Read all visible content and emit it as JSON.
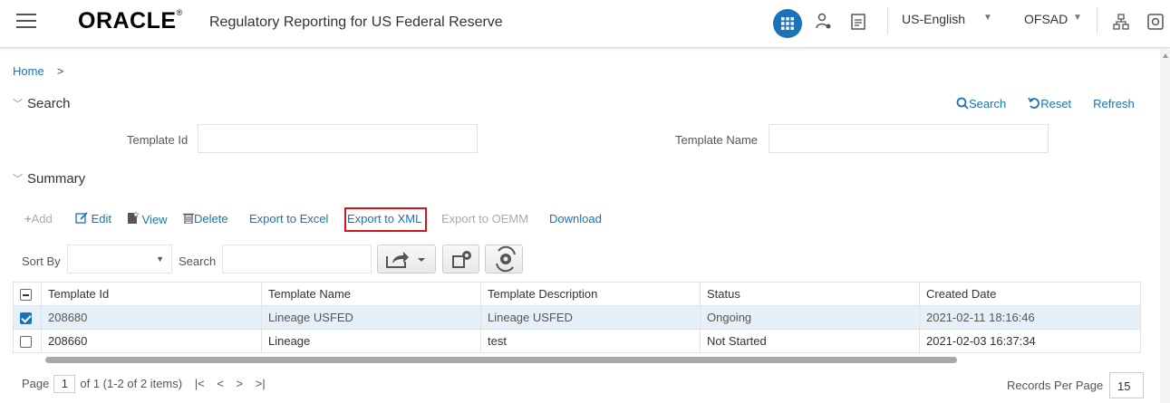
{
  "header": {
    "logo_text": "ORACLE",
    "logo_mark": "®",
    "app_title": "Regulatory Reporting for US Federal Reserve",
    "language": "US-English",
    "user": "OFSAD",
    "icons": [
      "menu-icon",
      "apps-grid-icon",
      "user-admin-icon",
      "notepad-icon",
      "hierarchy-icon",
      "profile-icon"
    ]
  },
  "breadcrumb": {
    "home": "Home",
    "separator": ">"
  },
  "search_section": {
    "title": "Search",
    "actions": {
      "search": "Search",
      "reset": "Reset",
      "refresh": "Refresh"
    },
    "fields": [
      {
        "label": "Template Id",
        "value": ""
      },
      {
        "label": "Template Name",
        "value": ""
      }
    ]
  },
  "summary_section": {
    "title": "Summary",
    "toolbar": {
      "add": "Add",
      "edit": "Edit",
      "view": "View",
      "delete": "Delete",
      "export_excel": "Export to Excel",
      "export_xml": "Export to XML",
      "export_oemm": "Export to OEMM",
      "download": "Download"
    },
    "sort_by_label": "Sort By",
    "sort_by_value": "",
    "search_label": "Search",
    "search_value": ""
  },
  "table": {
    "columns": [
      "Template Id",
      "Template Name",
      "Template Description",
      "Status",
      "Created Date"
    ],
    "rows": [
      {
        "checked": true,
        "cells": [
          "208680",
          "Lineage USFED",
          "Lineage USFED",
          "Ongoing",
          "2021-02-11 18:16:46"
        ]
      },
      {
        "checked": false,
        "cells": [
          "208660",
          "Lineage",
          "test",
          "Not Started",
          "2021-02-03 16:37:34"
        ]
      }
    ]
  },
  "pager": {
    "page_label": "Page",
    "page_number": "1",
    "page_info": "of 1 (1-2 of 2 items)",
    "records_per_page_label": "Records Per Page",
    "records_per_page": "15"
  },
  "colors": {
    "accent": "#1a73b8",
    "highlight_border": "#d7141a",
    "selected_row": "#e6f0f8"
  }
}
